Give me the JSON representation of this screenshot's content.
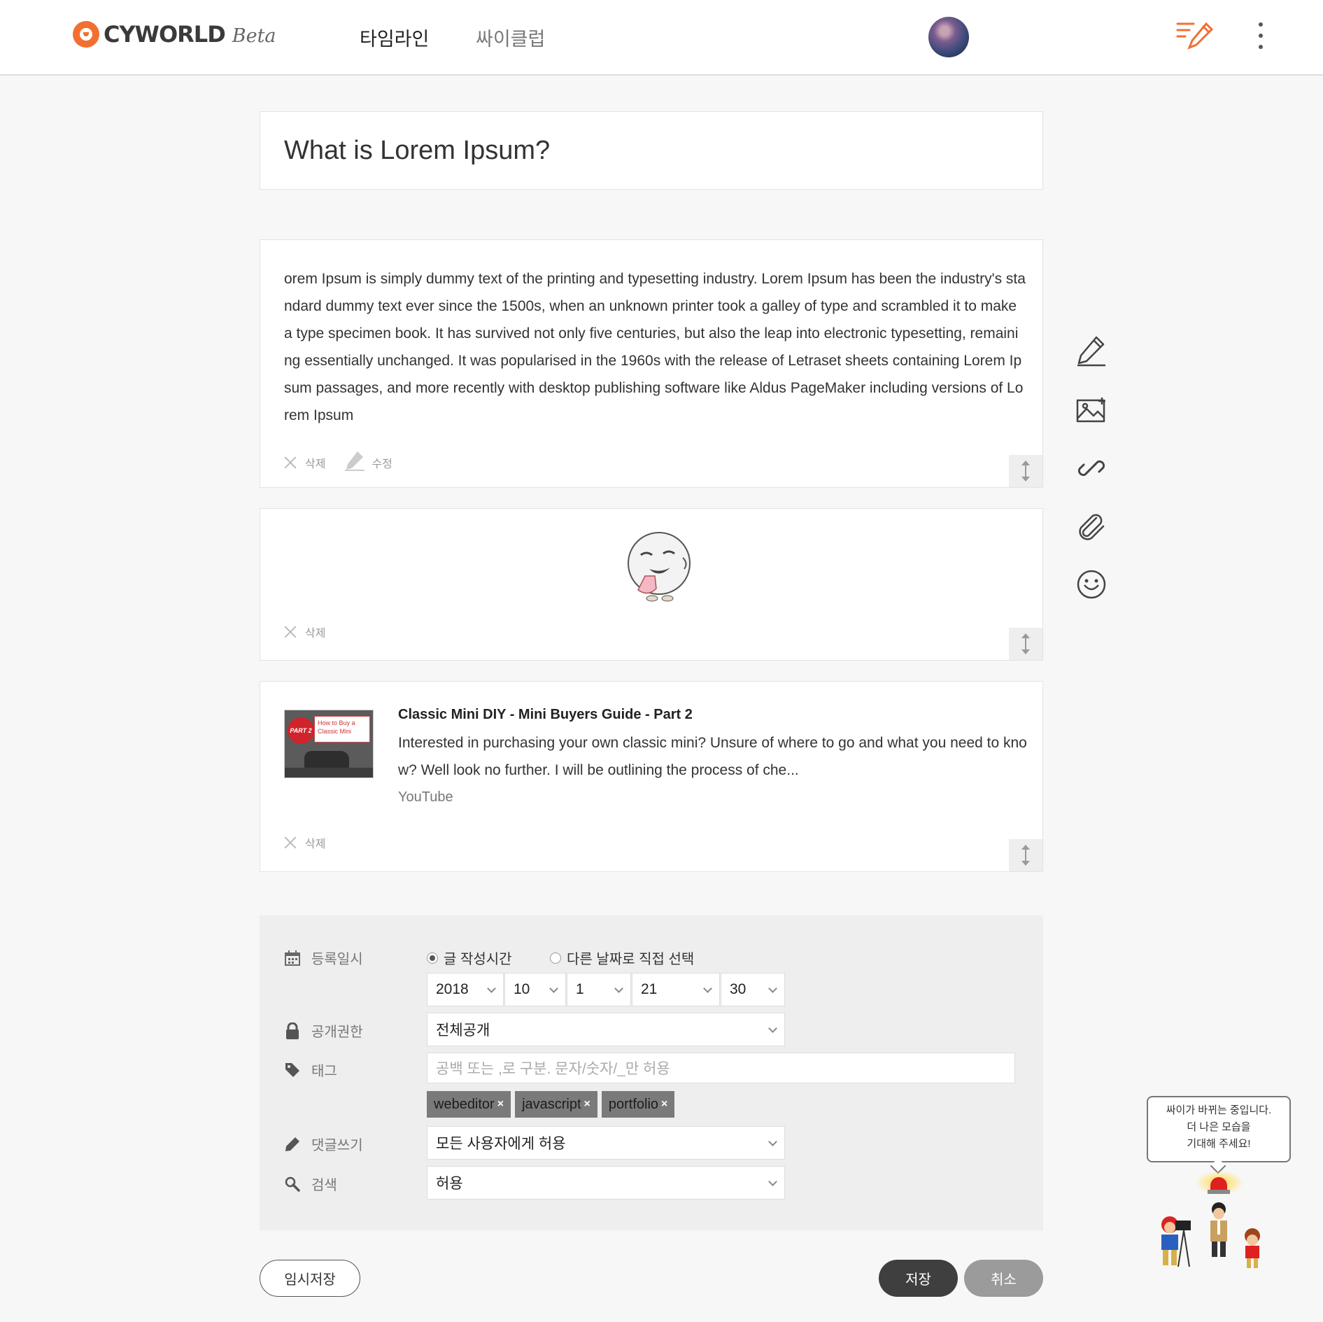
{
  "header": {
    "logo_text": "CYWORLD",
    "logo_beta": "Beta",
    "nav": [
      "타임라인",
      "싸이클럽"
    ]
  },
  "post": {
    "title": "What is Lorem Ipsum?",
    "body": "orem Ipsum is simply dummy text of the printing and typesetting industry. Lorem Ipsum has been the industry's standard dummy text ever since the 1500s, when an unknown printer took a galley of type and scrambled it to make a type specimen book. It has survived not only five centuries, but also the leap into electronic typesetting, remaining essentially unchanged. It was popularised in the 1960s with the release of Letraset sheets containing Lorem Ipsum passages, and more recently with desktop publishing software like Aldus PageMaker including versions of Lorem Ipsum",
    "delete_label": "삭제",
    "edit_label": "수정"
  },
  "link_card": {
    "title": "Classic Mini DIY - Mini Buyers Guide - Part 2",
    "description": "Interested in purchasing your own classic mini? Unsure of where to go and what you need to know? Well look no further. I will be outlining the process of che...",
    "source": "YouTube",
    "thumb_badge": "PART 2",
    "thumb_sign": "How to Buy a Classic Mini"
  },
  "settings": {
    "date_label": "등록일시",
    "radio_now": "글 작성시간",
    "radio_custom": "다른 날짜로 직접 선택",
    "year": "2018",
    "month": "10",
    "day": "1",
    "hour": "21",
    "minute": "30",
    "privacy_label": "공개권한",
    "privacy_value": "전체공개",
    "tag_label": "태그",
    "tag_placeholder": "공백 또는 ,로 구분. 문자/숫자/_만 허용",
    "tags": [
      "webeditor",
      "javascript",
      "portfolio"
    ],
    "comment_label": "댓글쓰기",
    "comment_value": "모든 사용자에게 허용",
    "search_label": "검색",
    "search_value": "허용"
  },
  "buttons": {
    "temp_save": "임시저장",
    "save": "저장",
    "cancel": "취소"
  },
  "notice": {
    "line1": "싸이가 바뀌는 중입니다.",
    "line2": "더 나은 모습을",
    "line3": "기대해 주세요!"
  },
  "colors": {
    "accent": "#f26f32",
    "save_button": "#3f3f3f",
    "cancel_button": "#9b9b9b",
    "tag_bg": "#7a7a7a"
  },
  "icons": {
    "toolbar": [
      "pencil-icon",
      "image-add-icon",
      "link-icon",
      "paperclip-icon",
      "emoticon-icon"
    ]
  }
}
